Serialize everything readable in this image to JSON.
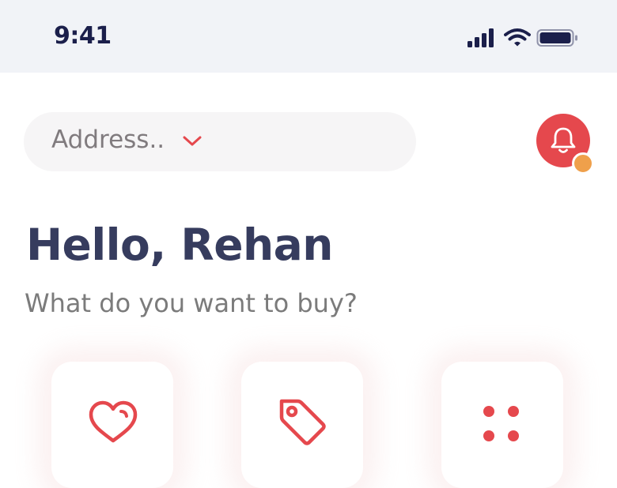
{
  "status_bar": {
    "time": "9:41",
    "icons": [
      "signal-icon",
      "wifi-icon",
      "battery-icon"
    ]
  },
  "header": {
    "address_placeholder": "Address..",
    "address_icon": "chevron-down-icon",
    "notification_icon": "bell-icon",
    "has_unread_notification": true
  },
  "greeting": {
    "title": "Hello, Rehan",
    "subtitle": "What do you want to buy?"
  },
  "categories": [
    {
      "icon": "heart-icon"
    },
    {
      "icon": "tag-icon"
    },
    {
      "icon": "grid-dots-icon"
    }
  ],
  "colors": {
    "accent": "#e5484d",
    "badge": "#efa04b",
    "heading": "#363c5e",
    "muted": "#7b7b7b",
    "status_bar_bg": "#f1f3f7"
  }
}
